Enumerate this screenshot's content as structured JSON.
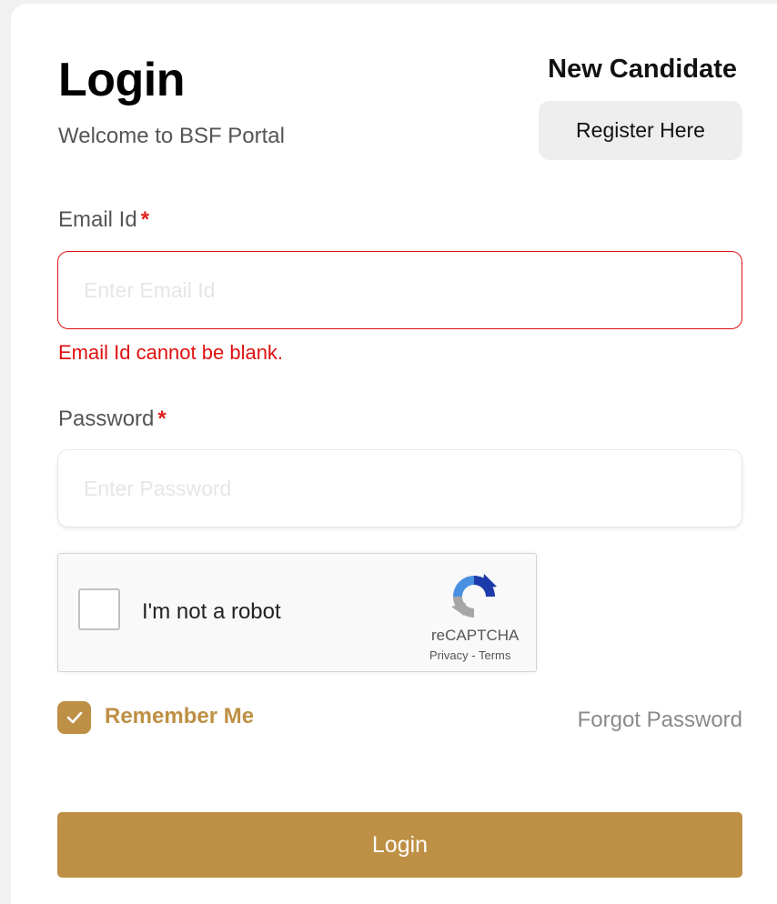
{
  "header": {
    "title": "Login",
    "subtitle": "Welcome to BSF Portal",
    "new_candidate_label": "New Candidate",
    "register_button": "Register Here"
  },
  "form": {
    "email": {
      "label": "Email Id",
      "required_marker": "*",
      "placeholder": "Enter Email Id",
      "value": "",
      "error": "Email Id cannot be blank."
    },
    "password": {
      "label": "Password",
      "required_marker": "*",
      "placeholder": "Enter Password",
      "value": ""
    }
  },
  "captcha": {
    "label": "I'm not a robot",
    "brand": "reCAPTCHA",
    "privacy": "Privacy",
    "separator": "-",
    "terms": "Terms",
    "checked": false
  },
  "options": {
    "remember_me": "Remember Me",
    "remember_checked": true,
    "forgot_password": "Forgot Password"
  },
  "actions": {
    "login_button": "Login"
  },
  "colors": {
    "accent": "#be9045",
    "error": "#e01010",
    "required": "#e02020"
  },
  "icons": {
    "remember_check": "checkmark-icon",
    "captcha_logo": "recaptcha-logo-icon"
  }
}
